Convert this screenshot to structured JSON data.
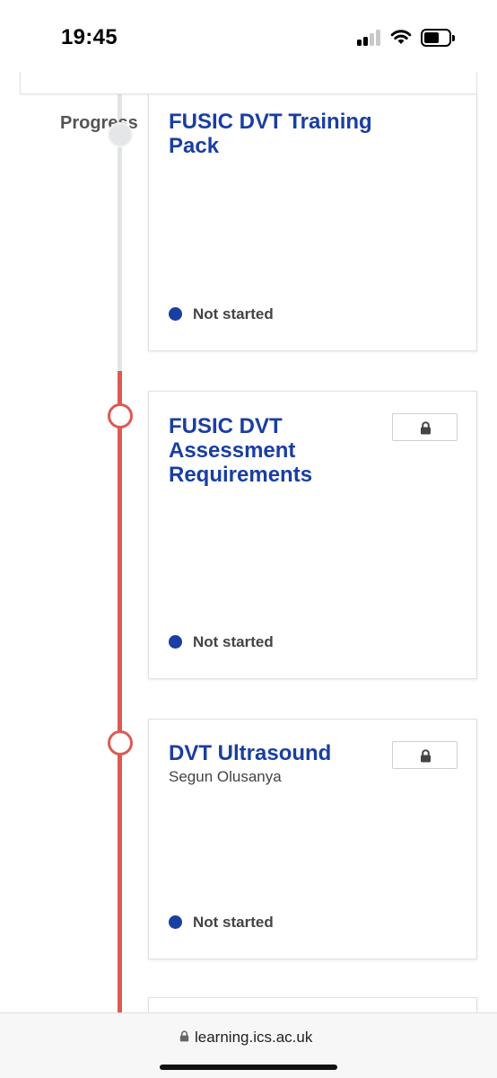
{
  "status_bar": {
    "time": "19:45"
  },
  "timeline": {
    "label": "Progress"
  },
  "cards": [
    {
      "title": "FUSIC DVT Training Pack",
      "status": "Not started",
      "locked": false
    },
    {
      "title": "FUSIC DVT Assessment Requirements",
      "status": "Not started",
      "locked": true,
      "lock_icon": "lock-icon"
    },
    {
      "title": "DVT Ultrasound",
      "subtitle": "Segun Olusanya",
      "status": "Not started",
      "locked": true,
      "lock_icon": "lock-icon"
    }
  ],
  "browser": {
    "url": "learning.ics.ac.uk"
  },
  "colors": {
    "title_blue": "#1a3ea1",
    "timeline_red": "#dd5a52",
    "timeline_grey": "#e1e4e6"
  }
}
